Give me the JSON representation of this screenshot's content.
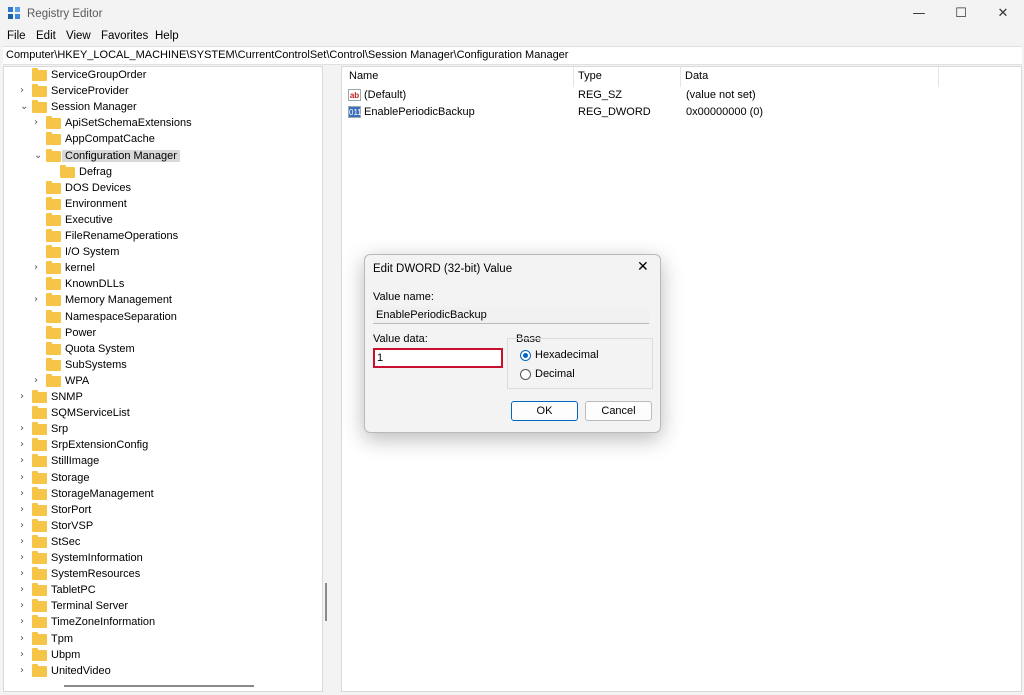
{
  "window": {
    "title": "Registry Editor"
  },
  "menu": [
    "File",
    "Edit",
    "View",
    "Favorites",
    "Help"
  ],
  "address": "Computer\\HKEY_LOCAL_MACHINE\\SYSTEM\\CurrentControlSet\\Control\\Session Manager\\Configuration Manager",
  "tree": [
    {
      "label": "ServiceGroupOrder",
      "indent": 0,
      "arrow": ""
    },
    {
      "label": "ServiceProvider",
      "indent": 0,
      "arrow": "›"
    },
    {
      "label": "Session Manager",
      "indent": 0,
      "arrow": "⌄"
    },
    {
      "label": "ApiSetSchemaExtensions",
      "indent": 1,
      "arrow": "›"
    },
    {
      "label": "AppCompatCache",
      "indent": 1,
      "arrow": ""
    },
    {
      "label": "Configuration Manager",
      "indent": 1,
      "arrow": "⌄",
      "selected": true
    },
    {
      "label": "Defrag",
      "indent": 2,
      "arrow": ""
    },
    {
      "label": "DOS Devices",
      "indent": 1,
      "arrow": ""
    },
    {
      "label": "Environment",
      "indent": 1,
      "arrow": ""
    },
    {
      "label": "Executive",
      "indent": 1,
      "arrow": ""
    },
    {
      "label": "FileRenameOperations",
      "indent": 1,
      "arrow": ""
    },
    {
      "label": "I/O System",
      "indent": 1,
      "arrow": ""
    },
    {
      "label": "kernel",
      "indent": 1,
      "arrow": "›"
    },
    {
      "label": "KnownDLLs",
      "indent": 1,
      "arrow": ""
    },
    {
      "label": "Memory Management",
      "indent": 1,
      "arrow": "›"
    },
    {
      "label": "NamespaceSeparation",
      "indent": 1,
      "arrow": ""
    },
    {
      "label": "Power",
      "indent": 1,
      "arrow": ""
    },
    {
      "label": "Quota System",
      "indent": 1,
      "arrow": ""
    },
    {
      "label": "SubSystems",
      "indent": 1,
      "arrow": ""
    },
    {
      "label": "WPA",
      "indent": 1,
      "arrow": "›"
    },
    {
      "label": "SNMP",
      "indent": 0,
      "arrow": "›"
    },
    {
      "label": "SQMServiceList",
      "indent": 0,
      "arrow": ""
    },
    {
      "label": "Srp",
      "indent": 0,
      "arrow": "›"
    },
    {
      "label": "SrpExtensionConfig",
      "indent": 0,
      "arrow": "›"
    },
    {
      "label": "StillImage",
      "indent": 0,
      "arrow": "›"
    },
    {
      "label": "Storage",
      "indent": 0,
      "arrow": "›"
    },
    {
      "label": "StorageManagement",
      "indent": 0,
      "arrow": "›"
    },
    {
      "label": "StorPort",
      "indent": 0,
      "arrow": "›"
    },
    {
      "label": "StorVSP",
      "indent": 0,
      "arrow": "›"
    },
    {
      "label": "StSec",
      "indent": 0,
      "arrow": "›"
    },
    {
      "label": "SystemInformation",
      "indent": 0,
      "arrow": "›"
    },
    {
      "label": "SystemResources",
      "indent": 0,
      "arrow": "›"
    },
    {
      "label": "TabletPC",
      "indent": 0,
      "arrow": "›"
    },
    {
      "label": "Terminal Server",
      "indent": 0,
      "arrow": "›"
    },
    {
      "label": "TimeZoneInformation",
      "indent": 0,
      "arrow": "›"
    },
    {
      "label": "Tpm",
      "indent": 0,
      "arrow": "›"
    },
    {
      "label": "Ubpm",
      "indent": 0,
      "arrow": "›"
    },
    {
      "label": "UnitedVideo",
      "indent": 0,
      "arrow": "›"
    }
  ],
  "list": {
    "headers": [
      "Name",
      "Type",
      "Data"
    ],
    "rows": [
      {
        "icon": "string-value-icon",
        "glyph": "ab",
        "name": "(Default)",
        "type": "REG_SZ",
        "data": "(value not set)"
      },
      {
        "icon": "dword-value-icon",
        "glyph": "011",
        "name": "EnablePeriodicBackup",
        "type": "REG_DWORD",
        "data": "0x00000000 (0)"
      }
    ]
  },
  "dialog": {
    "title": "Edit DWORD (32-bit) Value",
    "value_name_label": "Value name:",
    "value_name": "EnablePeriodicBackup",
    "value_data_label": "Value data:",
    "value_data": "1",
    "base_label": "Base",
    "base_options": [
      "Hexadecimal",
      "Decimal"
    ],
    "base_selected": "Hexadecimal",
    "ok": "OK",
    "cancel": "Cancel"
  }
}
